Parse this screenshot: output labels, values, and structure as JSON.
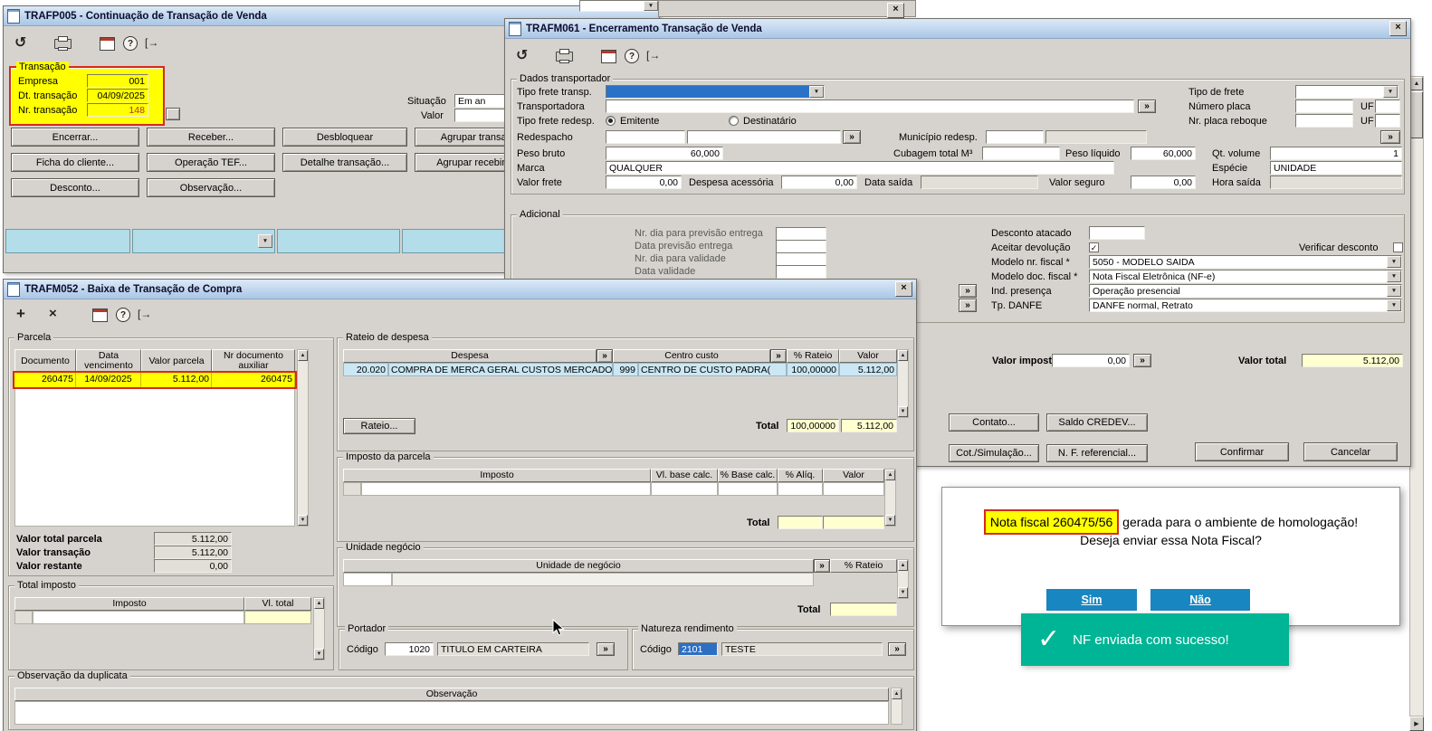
{
  "icons": {
    "undo": "↺",
    "add": "+",
    "del": "×",
    "help": "?",
    "exit": "[→",
    "chevron": "»",
    "caret": "▼",
    "up": "▲",
    "down": "▼",
    "right": "▶",
    "close": "×",
    "check": "✓"
  },
  "trafp005": {
    "title": "TRAFP005 - Continuação de Transação de Venda",
    "transacao": {
      "label": "Transação",
      "empresa_label": "Empresa",
      "empresa_value": "001",
      "dt_label": "Dt. transação",
      "dt_value": "04/09/2025",
      "nr_label": "Nr. transação",
      "nr_value": "148"
    },
    "situacao_label": "Situação",
    "situacao_value": "Em an",
    "valor_label": "Valor",
    "buttons": {
      "encerrar": "Encerrar...",
      "receber": "Receber...",
      "desbloquear": "Desbloquear",
      "agrupar_transacao": "Agrupar transaçã",
      "ficha_cliente": "Ficha do cliente...",
      "operacao_tef": "Operação TEF...",
      "detalhe_transacao": "Detalhe transação...",
      "agrupar_recebimento": "Agrupar recebimen",
      "desconto": "Desconto...",
      "observacao": "Observação..."
    }
  },
  "trafm061": {
    "title": "TRAFM061 - Encerramento Transação de Venda",
    "transp": {
      "label": "Dados transportador",
      "tipo_frete_transp": "Tipo frete transp.",
      "tipo_de_frete": "Tipo de frete",
      "transportadora": "Transportadora",
      "numero_placa": "Número placa",
      "uf": "UF",
      "tipo_frete_redesp": "Tipo frete redesp.",
      "emitente": "Emitente",
      "destinatario": "Destinatário",
      "nr_placa_reboque": "Nr. placa reboque",
      "redespacho": "Redespacho",
      "municipio_redesp": "Município redesp.",
      "peso_bruto_label": "Peso bruto",
      "peso_bruto": "60,000",
      "cubagem_label": "Cubagem total M³",
      "peso_liquido_label": "Peso líquido",
      "peso_liquido": "60,000",
      "qt_volume_label": "Qt. volume",
      "qt_volume": "1",
      "marca_label": "Marca",
      "marca": "QUALQUER",
      "especie_label": "Espécie",
      "especie": "UNIDADE",
      "valor_frete_label": "Valor frete",
      "valor_frete": "0,00",
      "despesa_acessoria_label": "Despesa acessória",
      "despesa_acessoria": "0,00",
      "data_saida_label": "Data saída",
      "valor_seguro_label": "Valor seguro",
      "valor_seguro": "0,00",
      "hora_saida_label": "Hora saída"
    },
    "adicional": {
      "label": "Adicional",
      "rows": [
        "Nr. dia para previsão entrega",
        "Data previsão entrega",
        "Nr. dia para validade",
        "Data validade"
      ],
      "desconto_atacado": "Desconto atacado",
      "aceitar_devolucao": "Aceitar devolução",
      "verificar_desconto": "Verificar desconto",
      "modelo_nr_fiscal_label": "Modelo nr. fiscal *",
      "modelo_nr_fiscal": "5050 - MODELO SAIDA",
      "modelo_doc_fiscal_label": "Modelo doc. fiscal *",
      "modelo_doc_fiscal": "Nota Fiscal Eletrônica (NF-e)",
      "ind_presenca_label": "Ind. presença",
      "ind_presenca": "Operação presencial",
      "tp_danfe_label": "Tp. DANFE",
      "tp_danfe": "DANFE normal, Retrato"
    },
    "valor_imposto_label": "Valor imposto",
    "valor_imposto": "0,00",
    "valor_total_label": "Valor total",
    "valor_total": "5.112,00",
    "buttons": {
      "contato": "Contato...",
      "saldo_credev": "Saldo CREDEV...",
      "cot_simulacao": "Cot./Simulação...",
      "nf_referencial": "N. F. referencial...",
      "confirmar": "Confirmar",
      "cancelar": "Cancelar"
    }
  },
  "trafm052": {
    "title": "TRAFM052 - Baixa de Transação de Compra",
    "parcela": {
      "label": "Parcela",
      "headers": [
        "Documento",
        "Data vencimento",
        "Valor parcela",
        "Nr documento auxiliar"
      ],
      "row": {
        "documento": "260475",
        "vencimento": "14/09/2025",
        "valor": "5.112,00",
        "nr_aux": "260475"
      },
      "valor_total_parcela_label": "Valor total parcela",
      "valor_total_parcela": "5.112,00",
      "valor_transacao_label": "Valor transação",
      "valor_transacao": "5.112,00",
      "valor_restante_label": "Valor restante",
      "valor_restante": "0,00"
    },
    "total_imposto": {
      "label": "Total imposto",
      "imposto_header": "Imposto",
      "vl_total_header": "Vl. total"
    },
    "rateio": {
      "label": "Rateio de despesa",
      "despesa_header": "Despesa",
      "centro_custo_header": "Centro custo",
      "rateio_header": "% Rateio",
      "valor_header": "Valor",
      "row": {
        "codigo": "20.020",
        "despesa": "COMPRA DE MERCA GERAL CUSTOS MERCADO",
        "cc_codigo": "999",
        "centro_custo": "CENTRO DE CUSTO PADRA(",
        "rateio": "100,00000",
        "valor": "5.112,00"
      },
      "rateio_button": "Rateio...",
      "total_label": "Total",
      "total_rateio": "100,00000",
      "total_valor": "5.112,00"
    },
    "imposto_parcela": {
      "label": "Imposto da parcela",
      "headers": [
        "Imposto",
        "Vl. base calc.",
        "% Base calc.",
        "% Alíq.",
        "Valor"
      ],
      "total_label": "Total"
    },
    "unidade_negocio": {
      "label": "Unidade negócio",
      "header": "Unidade de negócio",
      "rateio_header": "% Rateio",
      "total_label": "Total"
    },
    "portador": {
      "label": "Portador",
      "codigo_label": "Código",
      "codigo": "1020",
      "descricao": "TITULO EM CARTEIRA"
    },
    "natureza": {
      "label": "Natureza rendimento",
      "codigo_label": "Código",
      "codigo": "2101",
      "descricao": "TESTE"
    },
    "observacao": {
      "label": "Observação da duplicata",
      "header": "Observação"
    }
  },
  "dialog": {
    "highlight": "Nota fiscal 260475/56",
    "line1_rest": "gerada para o ambiente de homologação!",
    "line2": "Deseja enviar essa Nota Fiscal?",
    "sim": "Sim",
    "nao": "Não"
  },
  "toast": {
    "message": "NF enviada com sucesso!"
  }
}
